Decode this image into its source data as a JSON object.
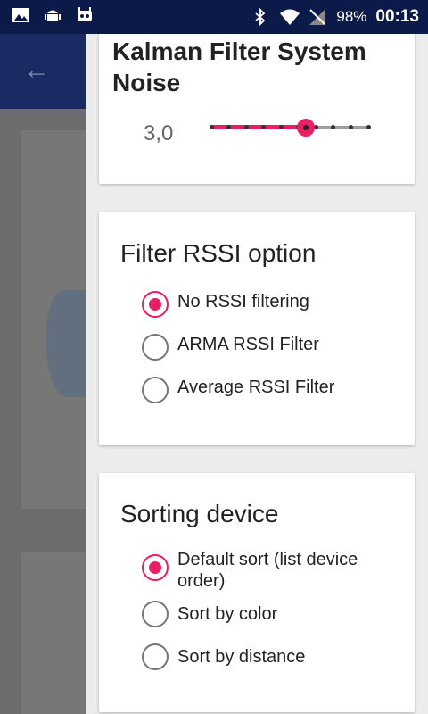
{
  "status_bar": {
    "battery": "98%",
    "time": "00:13",
    "left_icons": [
      "image-icon",
      "android-icon",
      "robot-icon"
    ],
    "right_icons": [
      "bluetooth-icon",
      "wifi-icon",
      "signal-off-icon"
    ]
  },
  "background": {
    "back_icon": "arrow-back-icon"
  },
  "kalman": {
    "title": "Kalman Filter System Noise",
    "value": "3,0",
    "slider_position": 0.6,
    "ticks": 10
  },
  "filter_rssi": {
    "title": "Filter RSSI option",
    "options": [
      {
        "label": "No RSSI filtering",
        "checked": true
      },
      {
        "label": "ARMA RSSI Filter",
        "checked": false
      },
      {
        "label": "Average RSSI Filter",
        "checked": false
      }
    ]
  },
  "sorting": {
    "title": "Sorting device",
    "options": [
      {
        "label": "Default sort (list device order)",
        "checked": true
      },
      {
        "label": "Sort by color",
        "checked": false
      },
      {
        "label": "Sort by distance",
        "checked": false
      }
    ]
  },
  "colors": {
    "accent": "#e91e63",
    "toolbar": "#1a2a63",
    "status_bar": "#0c1a4a"
  }
}
